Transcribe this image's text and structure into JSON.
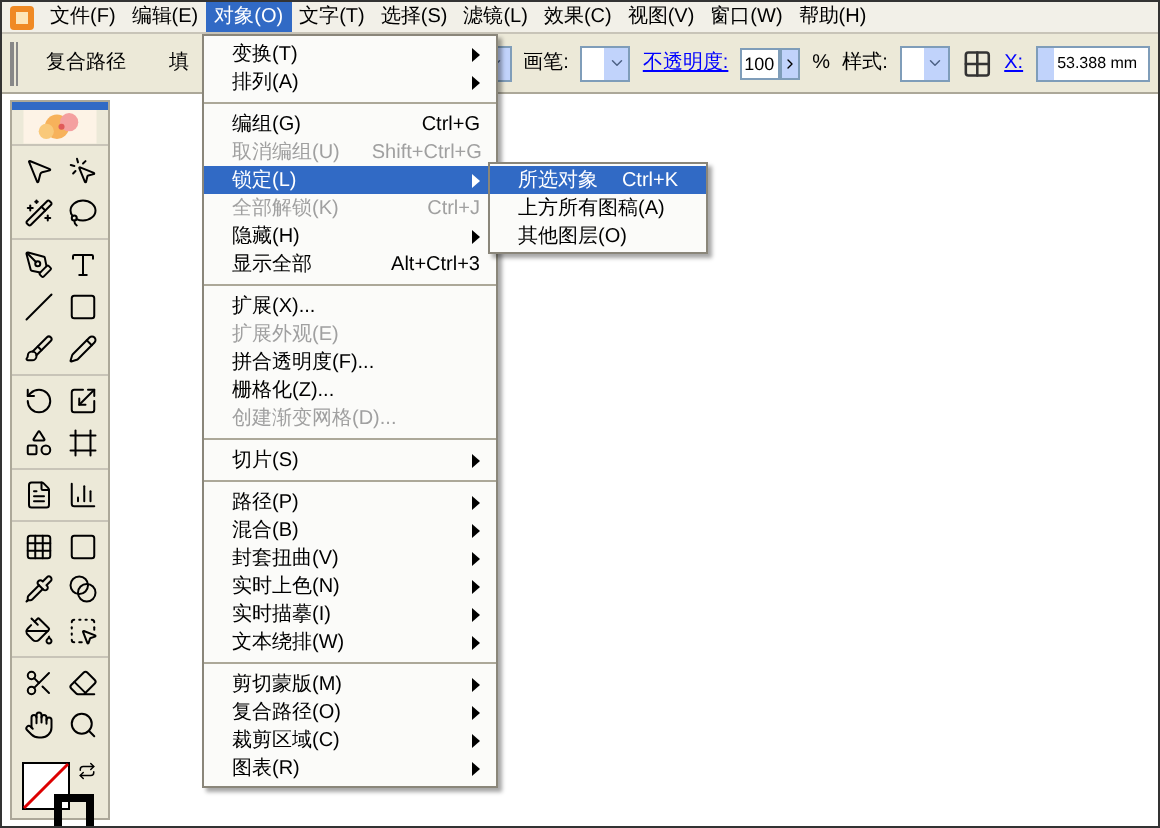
{
  "menubar": [
    {
      "label": "文件(F)",
      "selected": false
    },
    {
      "label": "编辑(E)",
      "selected": false
    },
    {
      "label": "对象(O)",
      "selected": true
    },
    {
      "label": "文字(T)",
      "selected": false
    },
    {
      "label": "选择(S)",
      "selected": false
    },
    {
      "label": "滤镜(L)",
      "selected": false
    },
    {
      "label": "效果(C)",
      "selected": false
    },
    {
      "label": "视图(V)",
      "selected": false
    },
    {
      "label": "窗口(W)",
      "selected": false
    },
    {
      "label": "帮助(H)",
      "selected": false
    }
  ],
  "toolbar": {
    "object_type": "复合路径",
    "fill_label": "填",
    "brush_label": "画笔:",
    "opacity_link": "不透明度:",
    "opacity_value": "100",
    "percent": "%",
    "style_label": "样式:",
    "x_link": "X:",
    "x_value": "53.388 mm"
  },
  "object_menu": [
    [
      {
        "label": "变换(T)",
        "submenu": true,
        "disabled": false,
        "selected": false
      },
      {
        "label": "排列(A)",
        "submenu": true,
        "disabled": false,
        "selected": false
      }
    ],
    [
      {
        "label": "编组(G)",
        "shortcut": "Ctrl+G",
        "submenu": false,
        "disabled": false,
        "selected": false
      },
      {
        "label": "取消编组(U)",
        "shortcut": "Shift+Ctrl+G",
        "submenu": false,
        "disabled": true,
        "selected": false
      },
      {
        "label": "锁定(L)",
        "submenu": true,
        "disabled": false,
        "selected": true
      },
      {
        "label": "全部解锁(K)",
        "shortcut": "Ctrl+J",
        "submenu": false,
        "disabled": true,
        "selected": false
      },
      {
        "label": "隐藏(H)",
        "submenu": true,
        "disabled": false,
        "selected": false
      },
      {
        "label": "显示全部",
        "shortcut": "Alt+Ctrl+3",
        "submenu": false,
        "disabled": false,
        "selected": false
      }
    ],
    [
      {
        "label": "扩展(X)...",
        "submenu": false,
        "disabled": false,
        "selected": false
      },
      {
        "label": "扩展外观(E)",
        "submenu": false,
        "disabled": true,
        "selected": false
      },
      {
        "label": "拼合透明度(F)...",
        "submenu": false,
        "disabled": false,
        "selected": false
      },
      {
        "label": "栅格化(Z)...",
        "submenu": false,
        "disabled": false,
        "selected": false
      },
      {
        "label": "创建渐变网格(D)...",
        "submenu": false,
        "disabled": true,
        "selected": false
      }
    ],
    [
      {
        "label": "切片(S)",
        "submenu": true,
        "disabled": false,
        "selected": false
      }
    ],
    [
      {
        "label": "路径(P)",
        "submenu": true,
        "disabled": false,
        "selected": false
      },
      {
        "label": "混合(B)",
        "submenu": true,
        "disabled": false,
        "selected": false
      },
      {
        "label": "封套扭曲(V)",
        "submenu": true,
        "disabled": false,
        "selected": false
      },
      {
        "label": "实时上色(N)",
        "submenu": true,
        "disabled": false,
        "selected": false
      },
      {
        "label": "实时描摹(I)",
        "submenu": true,
        "disabled": false,
        "selected": false
      },
      {
        "label": "文本绕排(W)",
        "submenu": true,
        "disabled": false,
        "selected": false
      }
    ],
    [
      {
        "label": "剪切蒙版(M)",
        "submenu": true,
        "disabled": false,
        "selected": false
      },
      {
        "label": "复合路径(O)",
        "submenu": true,
        "disabled": false,
        "selected": false
      },
      {
        "label": "裁剪区域(C)",
        "submenu": true,
        "disabled": false,
        "selected": false
      },
      {
        "label": "图表(R)",
        "submenu": true,
        "disabled": false,
        "selected": false
      }
    ]
  ],
  "lock_submenu": [
    {
      "label": "所选对象",
      "shortcut": "Ctrl+K",
      "selected": true
    },
    {
      "label": "上方所有图稿(A)",
      "selected": false
    },
    {
      "label": "其他图层(O)",
      "selected": false
    }
  ]
}
